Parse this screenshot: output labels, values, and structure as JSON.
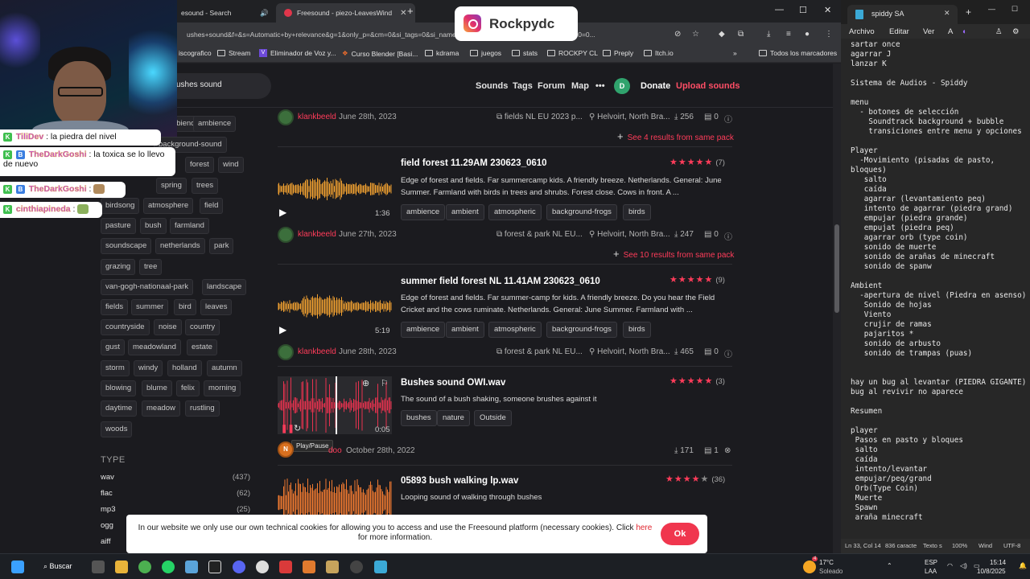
{
  "browser": {
    "tabs": [
      {
        "label": "esound - Search"
      },
      {
        "label": "Freesound - piezo-LeavesWind"
      }
    ],
    "url": "ushes+sound&f=&s=Automatic+by+relevance&g=1&only_p=&cm=0&si_tags=0&si_name=0&si_description=0&si_username=0&d0=0...",
    "bookmarks": [
      "iscografico",
      "Stream",
      "Eliminador de Voz y...",
      "Curso Blender [Basi...",
      "kdrama",
      "juegos",
      "stats",
      "ROCKPY CL",
      "Preply",
      "Itch.io"
    ],
    "all_bookmarks": "Todos los marcadores"
  },
  "nav": {
    "search_value": "ushes sound",
    "links": [
      "Sounds",
      "Tags",
      "Forum",
      "Map"
    ],
    "avatar_initial": "D",
    "donate": "Donate",
    "upload": "Upload sounds"
  },
  "tags": [
    "ambience",
    "background-sound",
    "forest",
    "wind",
    "spring",
    "trees",
    "birdsong",
    "atmosphere",
    "field",
    "pasture",
    "bush",
    "farmland",
    "soundscape",
    "netherlands",
    "park",
    "grazing",
    "tree",
    "van-gogh-nationaal-park",
    "landscape",
    "fields",
    "summer",
    "bird",
    "leaves",
    "countryside",
    "noise",
    "country",
    "gust",
    "meadowland",
    "estate",
    "storm",
    "windy",
    "holland",
    "autumn",
    "blowing",
    "blume",
    "felix",
    "morning",
    "daytime",
    "meadow",
    "rustling",
    "woods"
  ],
  "type_filter": {
    "heading": "TYPE",
    "items": [
      {
        "label": "wav",
        "count": "(437)"
      },
      {
        "label": "flac",
        "count": "(62)"
      },
      {
        "label": "mp3",
        "count": "(25)"
      },
      {
        "label": "ogg",
        "count": ""
      },
      {
        "label": "aiff",
        "count": ""
      }
    ]
  },
  "results": [
    {
      "user": "klankbeeld",
      "date": "June 28th, 2023",
      "pack": "fields NL EU 2023 p...",
      "location": "Helvoirt, North Bra...",
      "downloads": "256",
      "comments": "0",
      "more": "See 4 results from same pack"
    },
    {
      "title": "field forest 11.29AM 230623_0610",
      "rating_count": "(7)",
      "description": "Edge of forest and fields. Far summercamp kids. A friendly breeze. Netherlands. General: June Summer. Farmland with birds in trees and shrubs. Forest close. Cows in front. A ...",
      "duration": "1:36",
      "tags": [
        "ambience",
        "ambient",
        "atmospheric",
        "background-frogs",
        "birds"
      ],
      "user": "klankbeeld",
      "date": "June 27th, 2023",
      "pack": "forest & park NL EU...",
      "location": "Helvoirt, North Bra...",
      "downloads": "247",
      "comments": "0",
      "more": "See 10 results from same pack"
    },
    {
      "title": "summer field forest NL 11.41AM 230623_0610",
      "rating_count": "(9)",
      "description": "Edge of forest and fields. Far summer-camp for kids. A friendly breeze. Do you hear the Field Cricket and the cows ruminate. Netherlands. General: June Summer. Farmland with ...",
      "duration": "5:19",
      "tags": [
        "ambience",
        "ambient",
        "atmospheric",
        "background-frogs",
        "birds"
      ],
      "user": "klankbeeld",
      "date": "June 28th, 2023",
      "pack": "forest & park NL EU...",
      "location": "Helvoirt, North Bra...",
      "downloads": "465",
      "comments": "0"
    },
    {
      "title": "Bushes sound OWI.wav",
      "rating_count": "(3)",
      "description": "The sound of a bush shaking, someone brushes against it",
      "duration": "0:05",
      "tags": [
        "bushes",
        "nature",
        "Outside"
      ],
      "avatar_initial": "N",
      "user": "doo",
      "date": "October 28th, 2022",
      "downloads": "171",
      "comments": "1",
      "tooltip": "Play/Pause"
    },
    {
      "title": "05893 bush walking lp.wav",
      "rating_count": "(36)",
      "description": "Looping sound of walking through bushes"
    }
  ],
  "cookie": {
    "text": "In our website we only use our own technical cookies for allowing you to access and use the Freesound platform (necessary cookies). Click",
    "link": "here",
    "text2": "for more information.",
    "ok": "Ok"
  },
  "chat": [
    {
      "name": "TiliDev",
      "msg": ": la piedra del nivel"
    },
    {
      "name": "TheDarkGoshi",
      "msg": ": la toxica se lo llevo de nuevo"
    },
    {
      "name": "TheDarkGoshi",
      "msg": ":"
    },
    {
      "name": "cinthiapineda",
      "msg": ":"
    }
  ],
  "overlay": {
    "handle": "Rockpydc"
  },
  "notepad": {
    "tab": "spiddy SA",
    "menu": [
      "Archivo",
      "Editar",
      "Ver"
    ],
    "text": "sartar once\nagarrar J\nlanzar K\n\nSistema de Audios - Spiddy\n\nmenu\n  - botones de selección\n    Soundtrack background + bubble\n    transiciones entre menu y opciones\n\nPlayer\n  -Movimiento (pisadas de pasto,\nbloques)\n   salto\n   caída\n   agarrar (levantamiento peq)\n   intento de agarrar (piedra grand)\n   empujar (piedra grande)\n   empujat (piedra peq)\n   agarrar orb (type coin)\n   sonido de muerte\n   sonido de arañas de minecraft\n   sonido de spanw\n\nAmbient\n  -apertura de nivel (Piedra en asenso)\n   Sonido de hojas\n   Viento\n   crujir de ramas\n   pajaritos *\n   sonido de arbusto\n   sonido de trampas (puas)\n\n\nhay un bug al levantar (PIEDRA GIGANTE)\nbug al revivir no aparece\n\nResumen\n\nplayer\n Pasos en pasto y bloques\n salto\n caída\n intento/levantar\n empujar/peq/grand\n Orb(Type Coin)\n Muerte\n Spawn\n araña minecraft",
    "status": {
      "position": "Ln 33, Col 14",
      "chars": "836 caracte",
      "kind": "Texto s",
      "zoom": "100%",
      "eol": "Wind",
      "encoding": "UTF-8"
    }
  },
  "taskbar": {
    "search": "Buscar",
    "weather_temp": "17°C",
    "weather_desc": "Soleado",
    "lang": "ESP",
    "lang2": "LAA",
    "time": "15:14",
    "date": "10/8/2025",
    "weather_badge": "4"
  }
}
